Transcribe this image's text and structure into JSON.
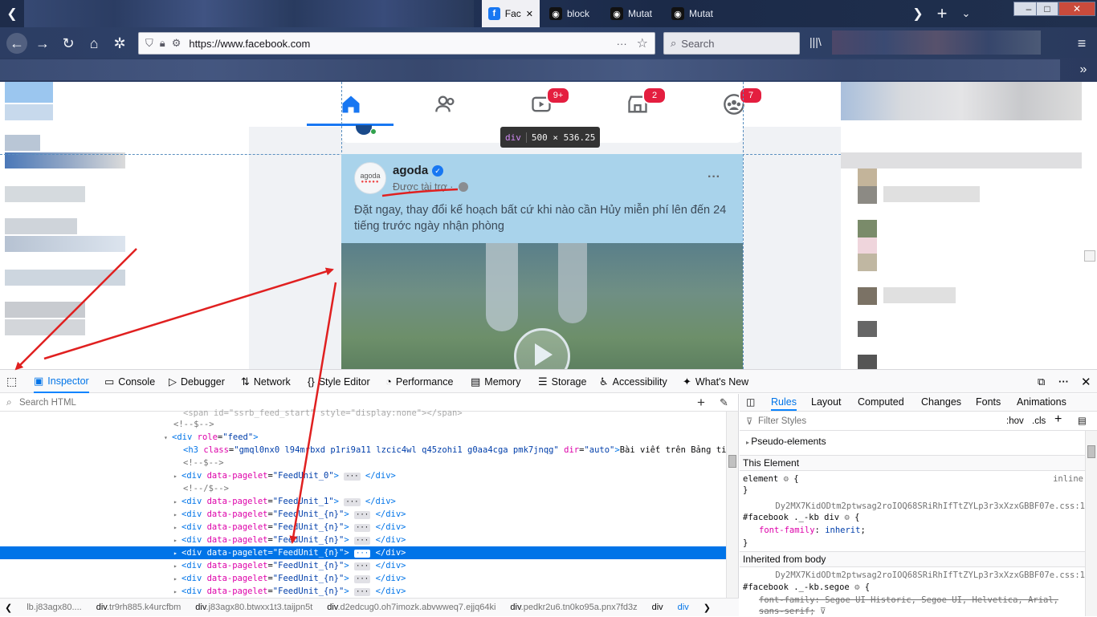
{
  "browser": {
    "tabs": [
      {
        "label": "Fac",
        "favicon": "facebook-icon",
        "active": true
      },
      {
        "label": "block",
        "favicon": "extension-icon",
        "active": false
      },
      {
        "label": "Mutat",
        "favicon": "extension-icon",
        "active": false
      },
      {
        "label": "Mutat",
        "favicon": "extension-icon",
        "active": false
      }
    ],
    "url": "https://www.facebook.com",
    "search_placeholder": "Search",
    "window_buttons": {
      "minimize": "–",
      "maximize": "□",
      "close": "✕"
    }
  },
  "facebook": {
    "nav_badges": {
      "watch": "9+",
      "marketplace": "2",
      "groups": "7"
    },
    "inspector_tooltip": {
      "tag": "div",
      "size": "500 × 536.25"
    },
    "post": {
      "author": "agoda",
      "logo_text": "agoda",
      "sponsored": "Được tài trợ ·",
      "body": "Đặt ngay, thay đổi kế hoạch bất cứ khi nào cần Hủy miễn phí lên đến 24 tiếng trước ngày nhận phòng",
      "more": "···"
    }
  },
  "devtools": {
    "tabs": [
      {
        "label": "Inspector",
        "icon": "inspector-icon",
        "active": true
      },
      {
        "label": "Console",
        "icon": "console-icon"
      },
      {
        "label": "Debugger",
        "icon": "debugger-icon"
      },
      {
        "label": "Network",
        "icon": "network-icon"
      },
      {
        "label": "Style Editor",
        "icon": "style-editor-icon"
      },
      {
        "label": "Performance",
        "icon": "performance-icon"
      },
      {
        "label": "Memory",
        "icon": "memory-icon"
      },
      {
        "label": "Storage",
        "icon": "storage-icon"
      },
      {
        "label": "Accessibility",
        "icon": "accessibility-icon"
      },
      {
        "label": "What's New",
        "icon": "whats-new-icon"
      }
    ],
    "search_placeholder": "Search HTML",
    "markup": {
      "line0": "<span id=\"ssrb_feed_start\" style=\"display:none\"></span>",
      "line1": "<!--$-->",
      "line2_tag": "div",
      "line2_attr": "role",
      "line2_val": "\"feed\"",
      "line3_class": "\"gmql0nx0 l94mrbxd p1ri9a11 lzcic4wl q45zohi1 g0aa4cga pmk7jnqg\"",
      "line3_dir": "\"auto\"",
      "line3_text": "Bài viết trên Bảng tin",
      "line4": "<!--$-->",
      "feed0": "\"FeedUnit_0\"",
      "line6": "<!--/$-->",
      "feed1": "\"FeedUnit_1\"",
      "feedn": "\"FeedUnit_{n}\"",
      "attr_pagelet": "data-pagelet",
      "dots": "···",
      "close_div": "</div>",
      "h3": "h3",
      "class_attr": "class",
      "dir_attr": "dir"
    },
    "breadcrumbs": [
      {
        "tag": "",
        "cls": "lb.j83agx80...."
      },
      {
        "tag": "div",
        "cls": ".tr9rh885.k4urcfbm"
      },
      {
        "tag": "div",
        "cls": ".j83agx80.btwxx1t3.taijpn5t"
      },
      {
        "tag": "div",
        "cls": ".d2edcug0.oh7imozk.abvwweq7.ejjq64ki"
      },
      {
        "tag": "div",
        "cls": ".pedkr2u6.tn0ko95a.pnx7fd3z"
      },
      {
        "tag": "div",
        "cls": ""
      },
      {
        "tag": "div",
        "cls": ""
      }
    ],
    "rules_tabs": [
      "Rules",
      "Layout",
      "Computed",
      "Changes",
      "Fonts",
      "Animations"
    ],
    "filter_placeholder": "Filter Styles",
    "hov": ":hov",
    "cls": ".cls",
    "pseudo": "Pseudo-elements",
    "this_element": "This Element",
    "element_rule": "element",
    "inline": "inline",
    "src1": "Dy2MX7KidODtm2ptwsag2roIOQ68SRiRhIfTtZYLp3r3xXzxGBBF07e.css:1",
    "selector1": "#facebook ._-kb div",
    "prop1": "font-family",
    "val1": "inherit",
    "inherited": "Inherited from body",
    "src2": "Dy2MX7KidODtm2ptwsag2roIOQ68SRiRhIfTtZYLp3r3xXzxGBBF07e.css:1",
    "selector2": "#facebook ._-kb.segoe",
    "prop2": "font-family",
    "val2": "Segoe UI Historic, Segoe UI, Helvetica, Arial, sans-serif",
    "open_brace": "{",
    "close_brace": "}"
  },
  "colors": {
    "accent": "#0074e8",
    "highlight": "#a9d3eb",
    "annotation_red": "#e02020",
    "badge": "#e41e3f"
  }
}
